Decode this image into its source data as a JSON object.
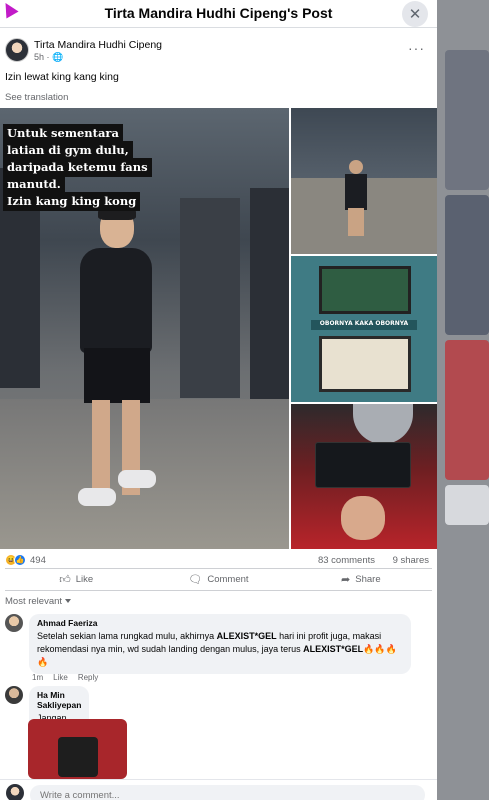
{
  "dialog": {
    "title": "Tirta Mandira Hudhi Cipeng's Post"
  },
  "post": {
    "author": "Tirta Mandira Hudhi Cipeng",
    "time": "5h · ",
    "privacy_icon": "globe-icon",
    "text": "Izin lewat king kang king",
    "see_translation": "See translation",
    "image_caption": [
      "Untuk sementara",
      "latian di gym dulu,",
      "daripada ketemu fans",
      "manutd.",
      "Izin kang king kong"
    ],
    "meme_banner": "OBORNYA KAKA OBORNYA"
  },
  "stats": {
    "reaction_count": "494",
    "comments": "83 comments",
    "shares": "9 shares"
  },
  "actions": {
    "like": "Like",
    "comment": "Comment",
    "share": "Share"
  },
  "sort": {
    "label": "Most relevant"
  },
  "comments": [
    {
      "name": "Ahmad Faeriza",
      "text_parts": [
        "Setelah sekian lama rungkad mulu, akhirnya ",
        "ALEXIST*GEL",
        " hari ini profit juga, makasi rekomendasi nya min, wd sudah landing dengan mulus, jaya terus ",
        "ALEXIST*GEL",
        "🔥🔥🔥🔥"
      ],
      "time": "1m",
      "like": "Like",
      "reply": "Reply"
    },
    {
      "name": "Ha Min Sakliyepan",
      "text": "Jangan lupa Madang biar gak kencot dok"
    }
  ],
  "composer": {
    "placeholder": "Write a comment..."
  },
  "colors": {
    "accent": "#1877f2",
    "bubble": "#f0f2f5",
    "secondary_text": "#65676b"
  }
}
